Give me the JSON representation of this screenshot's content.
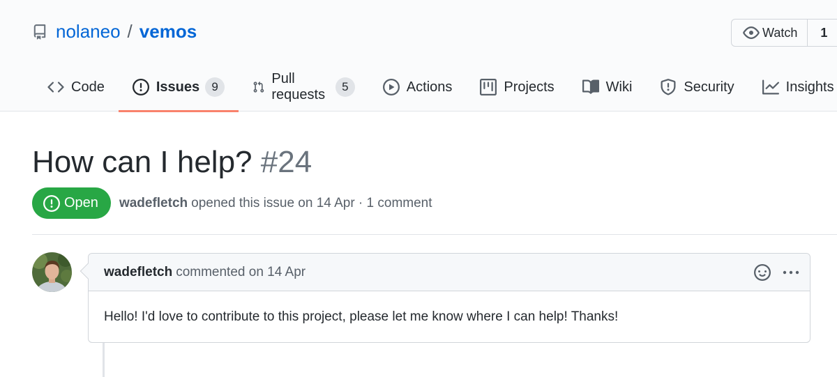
{
  "repo": {
    "owner": "nolaneo",
    "separator": "/",
    "name": "vemos"
  },
  "watch": {
    "label": "Watch",
    "count": "1"
  },
  "tabs": [
    {
      "label": "Code",
      "icon": "code-icon"
    },
    {
      "label": "Issues",
      "icon": "issue-opened-icon",
      "count": "9",
      "selected": true
    },
    {
      "label": "Pull requests",
      "icon": "git-pull-request-icon",
      "count": "5"
    },
    {
      "label": "Actions",
      "icon": "play-icon"
    },
    {
      "label": "Projects",
      "icon": "project-icon"
    },
    {
      "label": "Wiki",
      "icon": "book-icon"
    },
    {
      "label": "Security",
      "icon": "shield-icon"
    },
    {
      "label": "Insights",
      "icon": "graph-icon"
    }
  ],
  "issue": {
    "title": "How can I help?",
    "number": "#24",
    "state": "Open",
    "author": "wadefletch",
    "meta_text": "opened this issue on 14 Apr · 1 comment"
  },
  "comment": {
    "author": "wadefletch",
    "meta": "commented on 14 Apr",
    "body": "Hello! I'd love to contribute to this project, please let me know where I can help! Thanks!"
  },
  "colors": {
    "accent": "#0366d6",
    "open": "#28a745",
    "tab_underline": "#f9826c"
  }
}
